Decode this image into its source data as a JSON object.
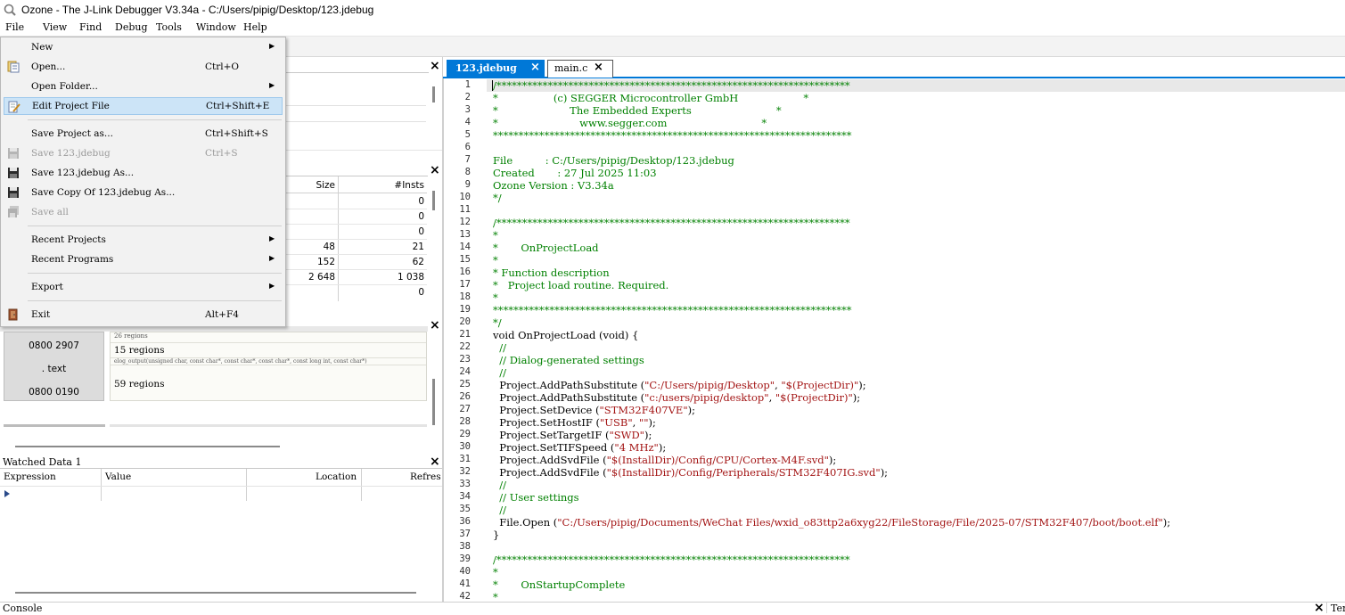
{
  "window": {
    "title": "Ozone - The J-Link Debugger V3.34a - C:/Users/pipig/Desktop/123.jdebug"
  },
  "menubar": [
    {
      "key": "file",
      "label": "File"
    },
    {
      "key": "view",
      "label": "View"
    },
    {
      "key": "find",
      "label": "Find"
    },
    {
      "key": "debug",
      "label": "Debug"
    },
    {
      "key": "tools",
      "label": "Tools"
    },
    {
      "key": "window",
      "label": "Window"
    },
    {
      "key": "help",
      "label": "Help"
    }
  ],
  "file_menu": {
    "new": {
      "label": "New",
      "submenu": true
    },
    "open": {
      "label": "Open...",
      "shortcut": "Ctrl+O"
    },
    "open_folder": {
      "label": "Open Folder...",
      "submenu": true
    },
    "edit_project": {
      "label": "Edit Project File",
      "shortcut": "Ctrl+Shift+E"
    },
    "save_project_as": {
      "label": "Save Project as...",
      "shortcut": "Ctrl+Shift+S"
    },
    "save_file": {
      "label": "Save 123.jdebug",
      "shortcut": "Ctrl+S",
      "disabled": true
    },
    "save_file_as": {
      "label": "Save 123.jdebug As..."
    },
    "save_copy": {
      "label": "Save Copy Of 123.jdebug As..."
    },
    "save_all": {
      "label": "Save all",
      "disabled": true
    },
    "recent_projects": {
      "label": "Recent Projects",
      "submenu": true
    },
    "recent_programs": {
      "label": "Recent Programs",
      "submenu": true
    },
    "export": {
      "label": "Export",
      "submenu": true
    },
    "exit": {
      "label": "Exit",
      "shortcut": "Alt+F4"
    }
  },
  "tabs": [
    {
      "label": "123.jdebug",
      "active": true
    },
    {
      "label": "main.c",
      "active": false
    }
  ],
  "functions_table": {
    "headers": {
      "size": "Size",
      "insts": "#Insts"
    },
    "rows": [
      {
        "size": "",
        "insts": "0"
      },
      {
        "size": "",
        "insts": "0"
      },
      {
        "size": "",
        "insts": "0"
      },
      {
        "size": "48",
        "insts": "21"
      },
      {
        "size": "152",
        "insts": "62"
      },
      {
        "size": "2 648",
        "insts": "1 038"
      },
      {
        "size": "",
        "insts": "0"
      }
    ]
  },
  "memory_usage": {
    "addr_top": "0800 2907",
    "section": ". text",
    "addr_bottom": "0800 0190",
    "regions_small": "26 regions",
    "regions_15": "15 regions",
    "func_sig": "elog_output(unsigned char, const char*, const char*, const char*, const long int, const char*)",
    "regions_59": "59 regions"
  },
  "watched": {
    "title": "Watched Data 1",
    "headers": {
      "expression": "Expression",
      "value": "Value",
      "location": "Location",
      "refresh": "Refres"
    }
  },
  "console": {
    "title": "Console",
    "right_label": "Ter"
  },
  "code": {
    "line_numbers": [
      "1",
      "2",
      "3",
      "4",
      "5",
      "6",
      "7",
      "8",
      "9",
      "10",
      "11",
      "12",
      "13",
      "14",
      "15",
      "16",
      "17",
      "18",
      "19",
      "20",
      "21",
      "22",
      "23",
      "24",
      "25",
      "26",
      "27",
      "28",
      "29",
      "30",
      "31",
      "32",
      "33",
      "34",
      "35",
      "36",
      "37",
      "38",
      "39",
      "40",
      "41",
      "42"
    ],
    "lines": [
      "/*********************************************************************",
      "*                 (c) SEGGER Microcontroller GmbH                    *",
      "*                      The Embedded Experts                          *",
      "*                         www.segger.com                             *",
      "**********************************************************************",
      "",
      "File          : C:/Users/pipig/Desktop/123.jdebug",
      "Created       : 27 Jul 2025 11:03",
      "Ozone Version : V3.34a",
      "*/",
      "",
      "/*********************************************************************",
      "*",
      "*       OnProjectLoad",
      "*",
      "* Function description",
      "*   Project load routine. Required.",
      "*",
      "**********************************************************************",
      "*/",
      "void OnProjectLoad (void) {",
      "  //",
      "  // Dialog-generated settings",
      "  //",
      "  Project.AddPathSubstitute (\"C:/Users/pipig/Desktop\", \"$(ProjectDir)\");",
      "  Project.AddPathSubstitute (\"c:/users/pipig/desktop\", \"$(ProjectDir)\");",
      "  Project.SetDevice (\"STM32F407VE\");",
      "  Project.SetHostIF (\"USB\", \"\");",
      "  Project.SetTargetIF (\"SWD\");",
      "  Project.SetTIFSpeed (\"4 MHz\");",
      "  Project.AddSvdFile (\"$(InstallDir)/Config/CPU/Cortex-M4F.svd\");",
      "  Project.AddSvdFile (\"$(InstallDir)/Config/Peripherals/STM32F407IG.svd\");",
      "  //",
      "  // User settings",
      "  //",
      "  File.Open (\"C:/Users/pipig/Documents/WeChat Files/wxid_o83ttp2a6xyg22/FileStorage/File/2025-07/STM32F407/boot/boot.elf\");",
      "}",
      "",
      "/*********************************************************************",
      "*",
      "*       OnStartupComplete",
      "*"
    ]
  },
  "colors": {
    "accent": "#0078d7",
    "comment": "#008000",
    "string": "#a31515",
    "menu_highlight": "#cce4f7"
  }
}
